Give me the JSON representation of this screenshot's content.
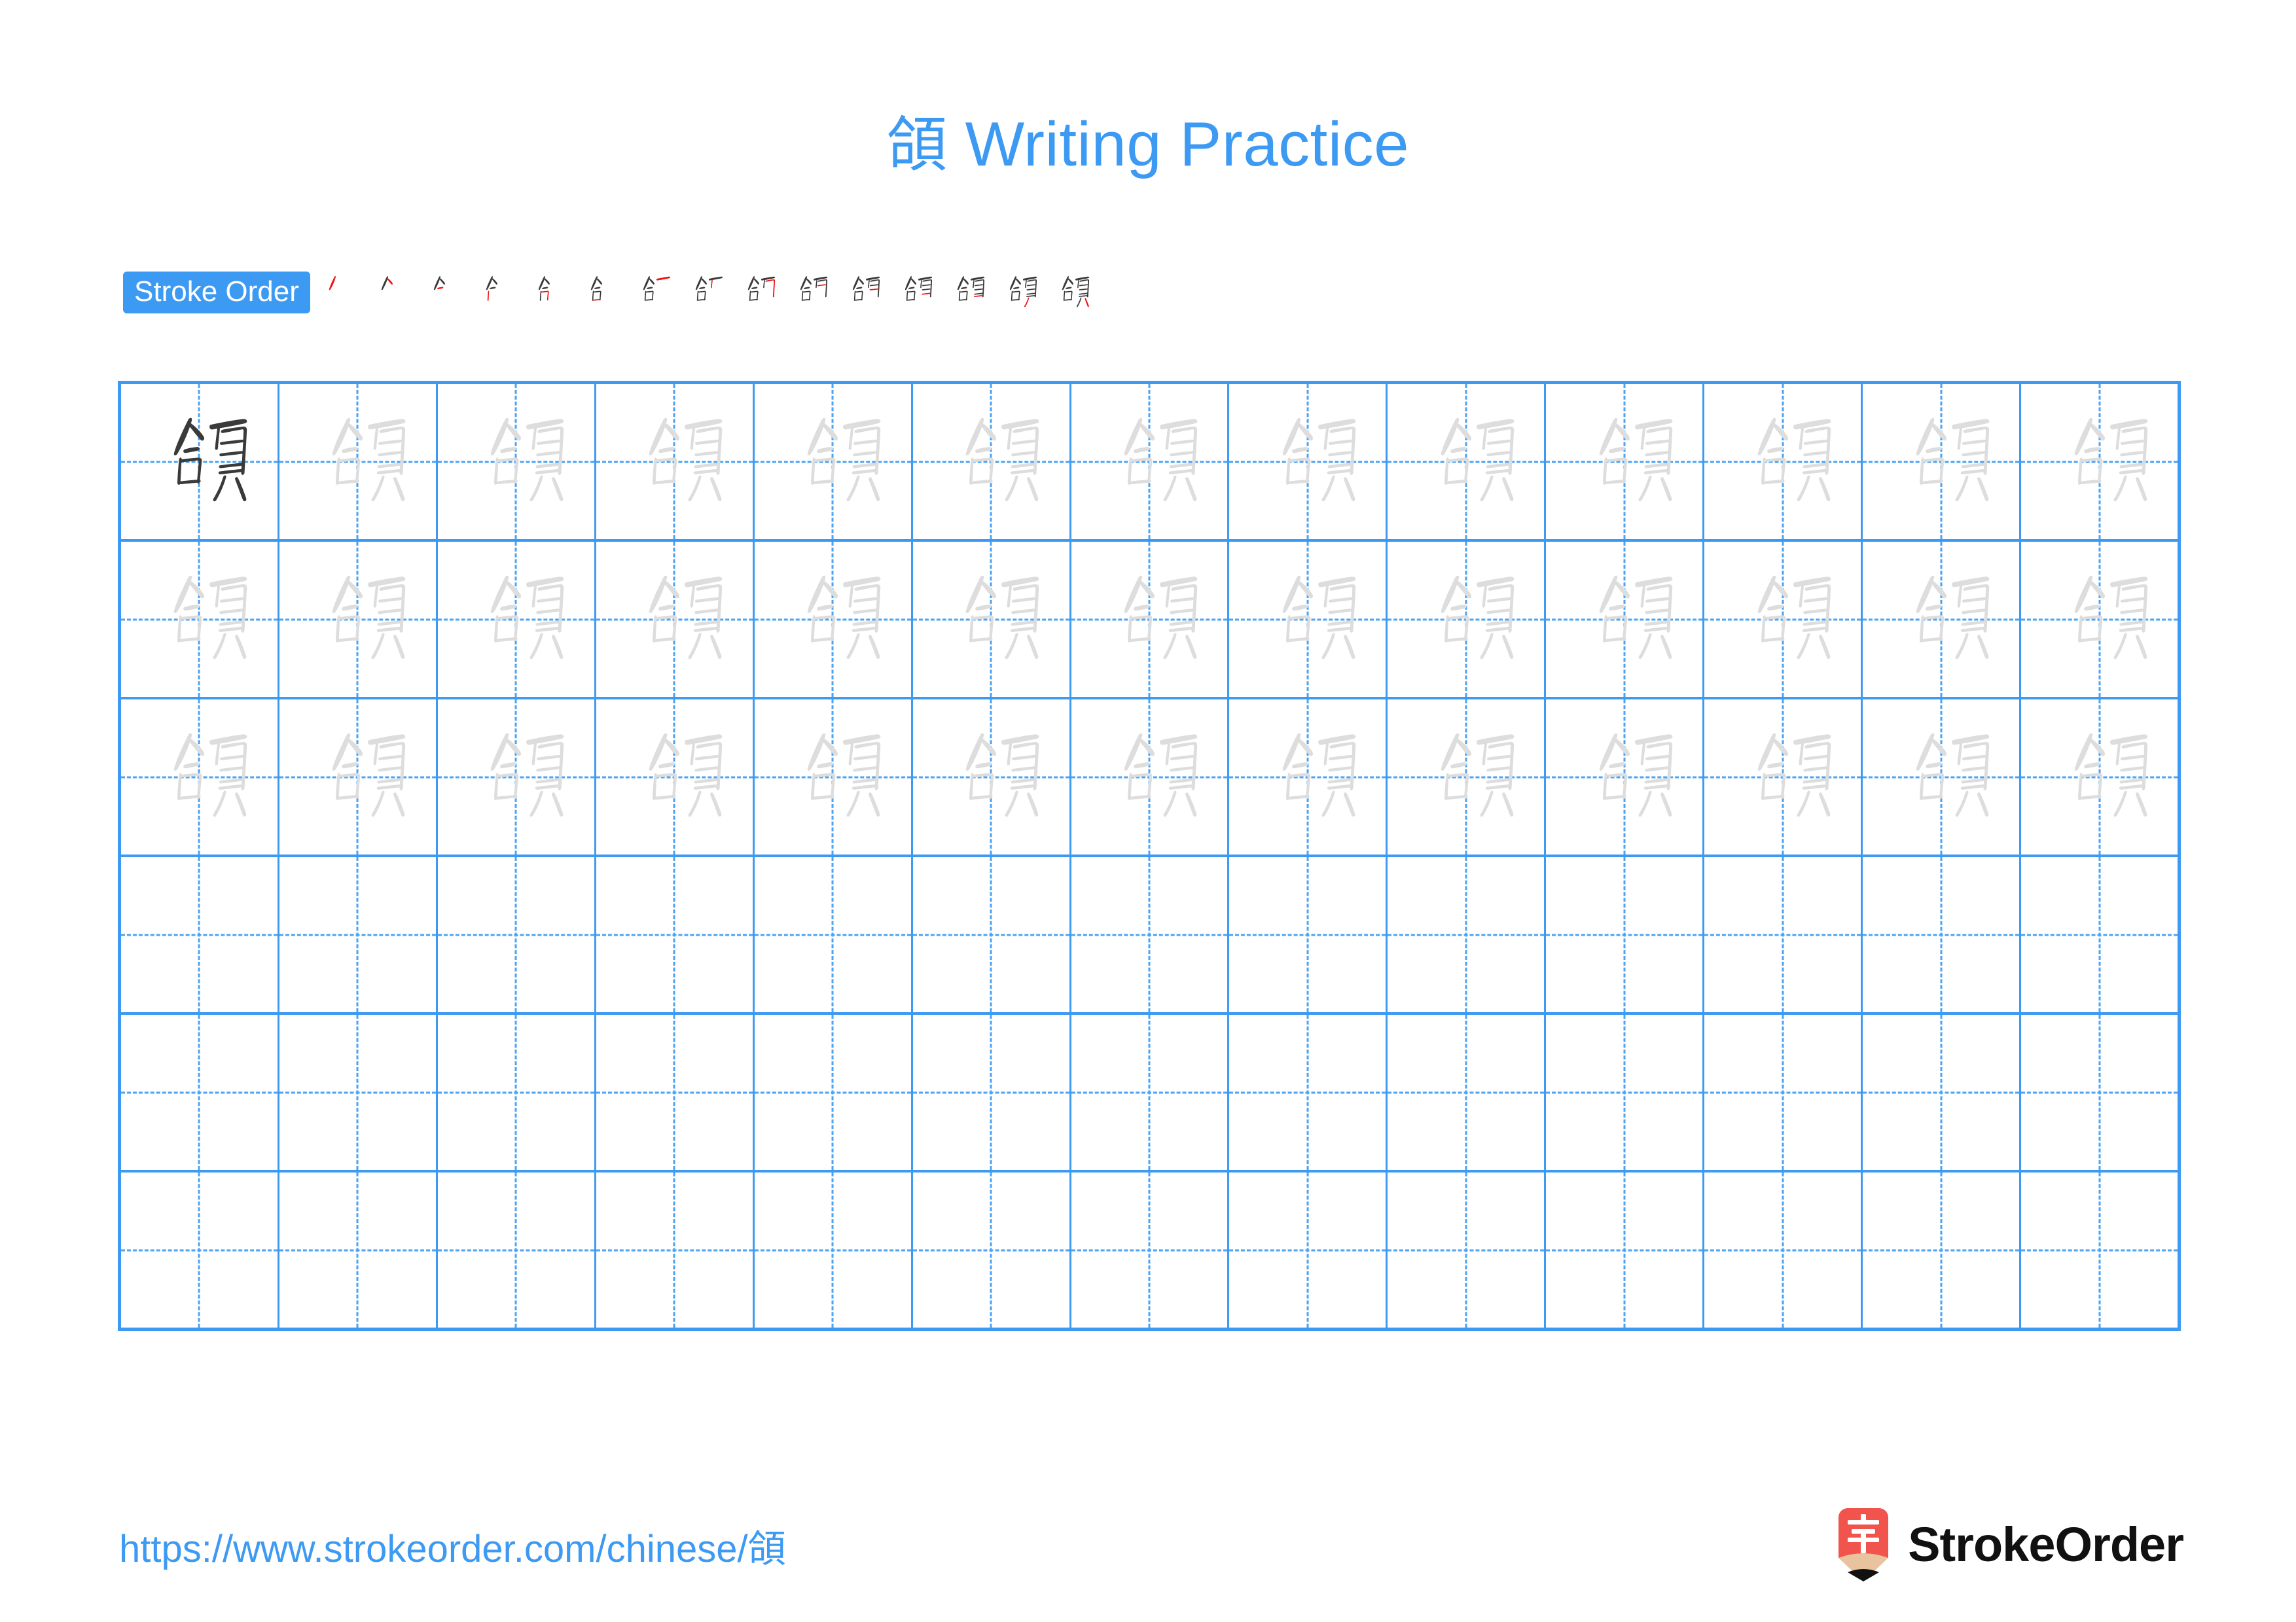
{
  "document": {
    "character": "頜",
    "title_suffix": " Writing Practice",
    "title_full": "頜 Writing Practice"
  },
  "stroke_order": {
    "badge_label": "Stroke Order",
    "stroke_count": 15,
    "new_stroke_color": "#ee1111",
    "existing_stroke_color": "#3a3a3a",
    "steps": [
      {
        "index": 1,
        "partial": "丿"
      },
      {
        "index": 2,
        "partial": "人"
      },
      {
        "index": 3,
        "partial": "亽"
      },
      {
        "index": 4,
        "partial": "亼"
      },
      {
        "index": 5,
        "partial": "合"
      },
      {
        "index": 6,
        "partial": "合"
      },
      {
        "index": 7,
        "partial": "合"
      },
      {
        "index": 8,
        "partial": "𠆢合一"
      },
      {
        "index": 9,
        "partial": "頜"
      },
      {
        "index": 10,
        "partial": "頜"
      },
      {
        "index": 11,
        "partial": "頜"
      },
      {
        "index": 12,
        "partial": "頜"
      },
      {
        "index": 13,
        "partial": "頜"
      },
      {
        "index": 14,
        "partial": "頜"
      },
      {
        "index": 15,
        "partial": "頜"
      }
    ]
  },
  "practice_grid": {
    "columns": 13,
    "rows": 6,
    "row_types": [
      "model-then-trace",
      "trace",
      "trace",
      "blank",
      "blank",
      "blank"
    ],
    "model_character": "頜",
    "trace_character": "頜",
    "grid_line_color": "#3d9af2",
    "guide_line_color": "#4aa3f5",
    "model_ink_color": "#3a3a3a",
    "trace_ink_color": "#dddddd"
  },
  "footer": {
    "url": "https://www.strokeorder.com/chinese/頜",
    "brand_name": "StrokeOrder",
    "logo_character": "字",
    "logo_color": "#f0544c",
    "logo_wood_color": "#e8c39e"
  },
  "theme": {
    "accent_blue": "#3d9af2",
    "background": "#ffffff",
    "ink": "#3a3a3a"
  }
}
